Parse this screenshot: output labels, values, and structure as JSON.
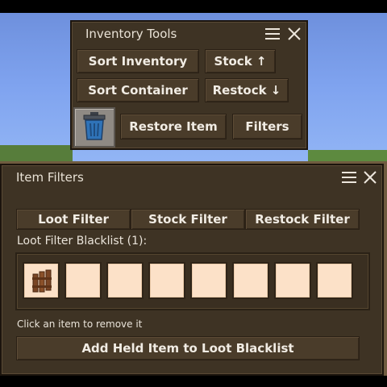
{
  "inventory_tools": {
    "title": "Inventory Tools",
    "buttons": {
      "sort_inventory": "Sort Inventory",
      "stock": "Stock ↑",
      "sort_container": "Sort Container",
      "restock": "Restock ↓",
      "restore_item": "Restore Item",
      "filters": "Filters"
    },
    "trash_icon": "trash-can-icon"
  },
  "item_filters": {
    "title": "Item Filters",
    "tabs": [
      "Loot Filter",
      "Stock Filter",
      "Restock Filter"
    ],
    "blacklist_label": "Loot Filter Blacklist (1):",
    "slots": [
      {
        "item_icon": "wooden-fence-icon",
        "filled": true
      },
      {
        "filled": false
      },
      {
        "filled": false
      },
      {
        "filled": false
      },
      {
        "filled": false
      },
      {
        "filled": false
      },
      {
        "filled": false
      },
      {
        "filled": false
      }
    ],
    "hint": "Click an item to remove it",
    "add_button": "Add Held Item to Loot Blacklist"
  },
  "colors": {
    "panel": "#3e3324",
    "button": "#4a3c2a",
    "slot": "#fce1c8",
    "text": "#f1ece4"
  }
}
